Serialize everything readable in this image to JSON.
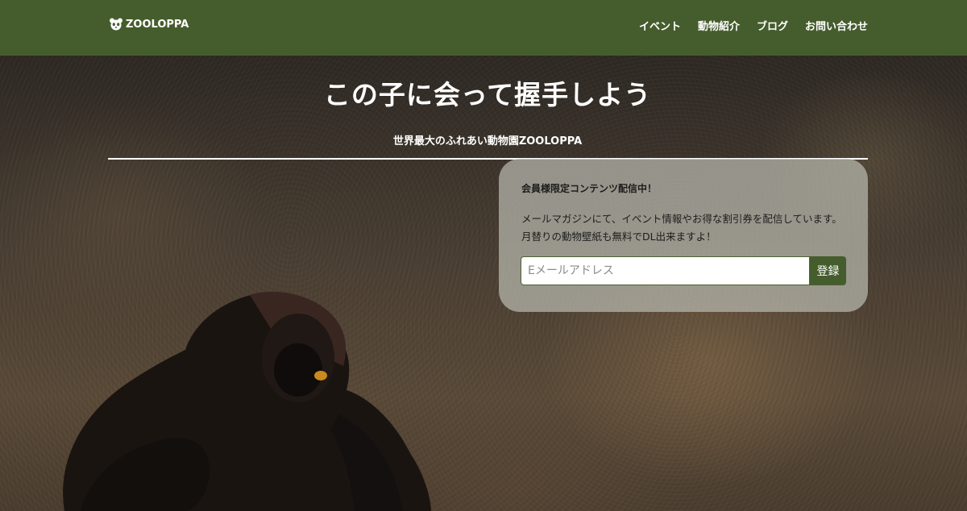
{
  "header": {
    "logo_text": "ZOOLOPPA",
    "logo_icon": "panda-icon",
    "nav": [
      "イベント",
      "動物紹介",
      "ブログ",
      "お問い合わせ"
    ]
  },
  "hero": {
    "title": "この子に会って握手しよう",
    "subtitle": "世界最大のふれあい動物園ZOOLOPPA"
  },
  "signup": {
    "title": "会員様限定コンテンツ配信中！",
    "body": "メールマガジンにて、イベント情報やお得な割引券を配信しています。月替りの動物壁紙も無料でDL出来ますよ！",
    "email_placeholder": "Eメールアドレス",
    "email_value": "",
    "submit_label": "登録"
  },
  "colors": {
    "brand_green": "#455d2d",
    "card_bg": "rgba(185,185,175,0.72)"
  }
}
